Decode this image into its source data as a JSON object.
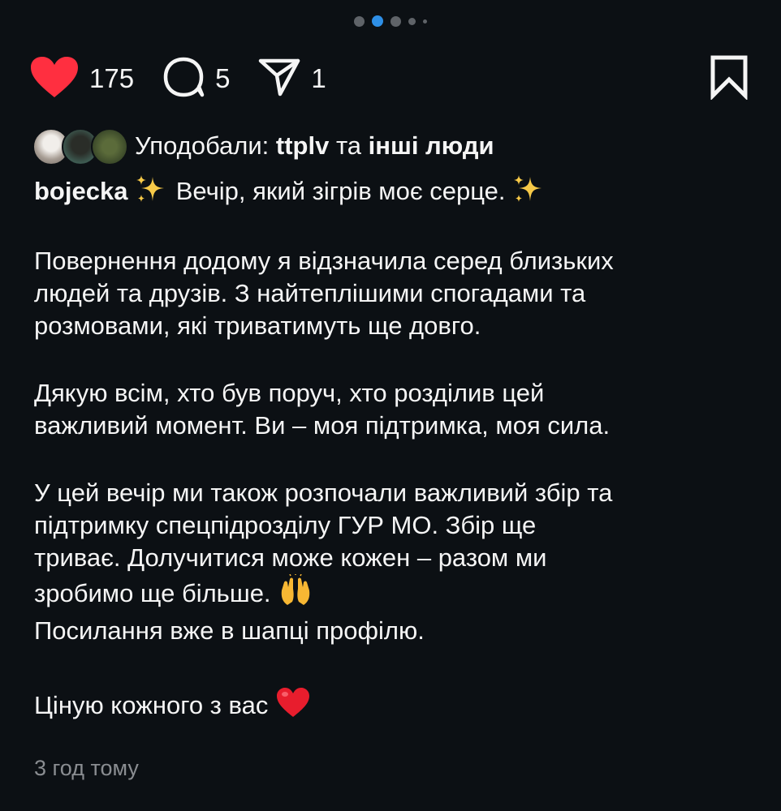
{
  "carousel": {
    "total": 5,
    "active": 1
  },
  "actions": {
    "likes_count": "175",
    "comments_count": "5",
    "shares_count": "1"
  },
  "liked_by": {
    "prefix": "Уподобали: ",
    "user": "ttplv",
    "connector": " та ",
    "others": "інші люди"
  },
  "caption": {
    "username": "bojecka",
    "title": " Вечір, який зігрів моє серце. ",
    "p1_l1": "Повернення додому я відзначила серед близьких",
    "p1_l2": "людей та друзів. З найтеплішими спогадами та",
    "p1_l3": "розмовами, які триватимуть ще довго.",
    "p2_l1": "Дякую всім, хто був поруч, хто розділив цей",
    "p2_l2": "важливий момент. Ви – моя підтримка, моя сила.",
    "p3_l1": "У цей вечір ми також розпочали важливий збір та",
    "p3_l2": "підтримку спецпідрозділу ГУР МО. Збір ще",
    "p3_l3": "триває. Долучитися може кожен – разом ми",
    "p3_l4": "зробимо ще більше. ",
    "p3_l5": "Посилання вже в шапці профілю.",
    "p4_l1": "Ціную кожного з вас "
  },
  "timestamp": "3 год тому",
  "colors": {
    "background": "#0c1014",
    "heart": "#ff2f40",
    "active_dot": "#2e8fe6"
  },
  "icons": [
    "heart-icon",
    "comment-icon",
    "share-icon",
    "bookmark-icon",
    "sparkles-icon",
    "raised-hands-icon",
    "red-heart-icon"
  ]
}
